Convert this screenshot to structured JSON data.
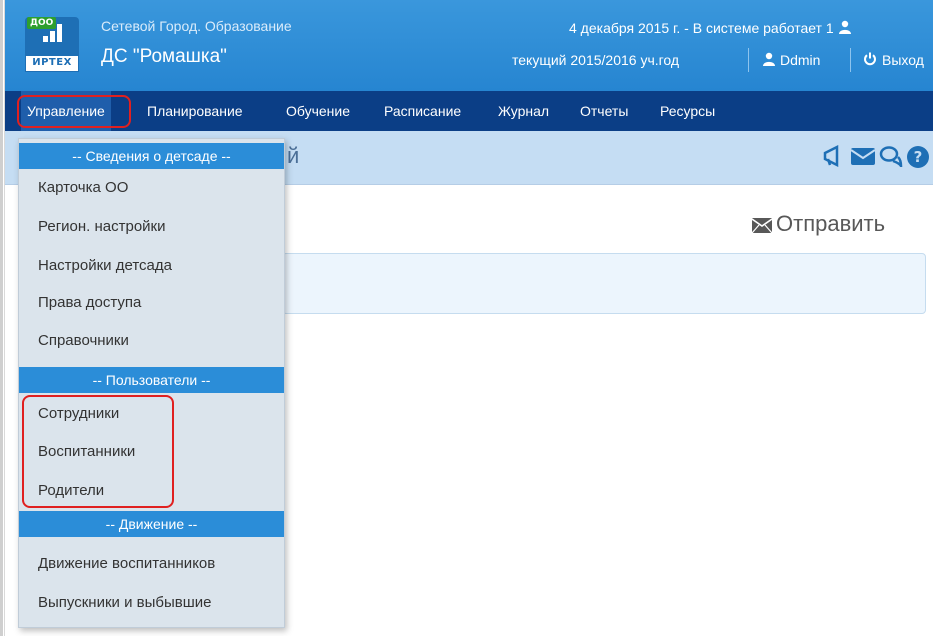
{
  "header": {
    "logo": {
      "badge": "ДОО",
      "brand": "ИРТЕХ"
    },
    "app_title": "Сетевой Город. Образование",
    "school_name": "ДС \"Ромашка\"",
    "status": "4 декабря 2015 г. - В системе работает 1",
    "year": "текущий 2015/2016 уч.год",
    "user": "Ddmin",
    "logout": "Выход"
  },
  "menu": {
    "items": [
      "Управление",
      "Планирование",
      "Обучение",
      "Расписание",
      "Журнал",
      "Отчеты",
      "Ресурсы"
    ],
    "active": "Управление"
  },
  "subbar": {
    "title_tail": "й",
    "icons": [
      "megaphone-icon",
      "mail-icon",
      "chat-icon",
      "help-icon"
    ]
  },
  "content": {
    "send_label": "Отправить"
  },
  "dropdown": {
    "section1": "-- Сведения о детсаде --",
    "items1": [
      "Карточка ОО",
      "Регион. настройки",
      "Настройки детсада",
      "Права доступа",
      "Справочники"
    ],
    "section2": "-- Пользователи --",
    "items2": [
      "Сотрудники",
      "Воспитанники",
      "Родители"
    ],
    "section3": "-- Движение --",
    "items3": [
      "Движение воспитанников",
      "Выпускники и выбывшие"
    ]
  },
  "colors": {
    "header": "#2b8dd8",
    "menubar": "#0b3e86",
    "subbar": "#c5ddf3",
    "dropdown": "#dbe4ec",
    "highlight": "#e02020"
  }
}
